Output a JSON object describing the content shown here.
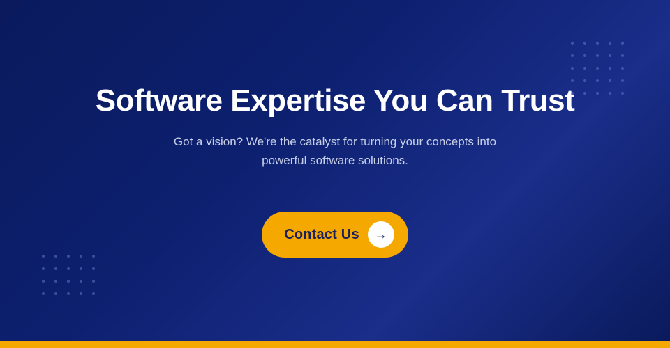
{
  "hero": {
    "title": "Software Expertise You Can Trust",
    "subtitle": "Got a vision? We're the catalyst for turning your concepts into powerful software solutions.",
    "cta_label": "Contact Us",
    "cta_arrow": "→"
  },
  "colors": {
    "background_start": "#0a1a5c",
    "background_end": "#1a2e8a",
    "accent": "#f5a800",
    "text_primary": "#ffffff",
    "text_secondary": "#c8d0e8",
    "dot_color": "rgba(100, 130, 200, 0.5)"
  }
}
